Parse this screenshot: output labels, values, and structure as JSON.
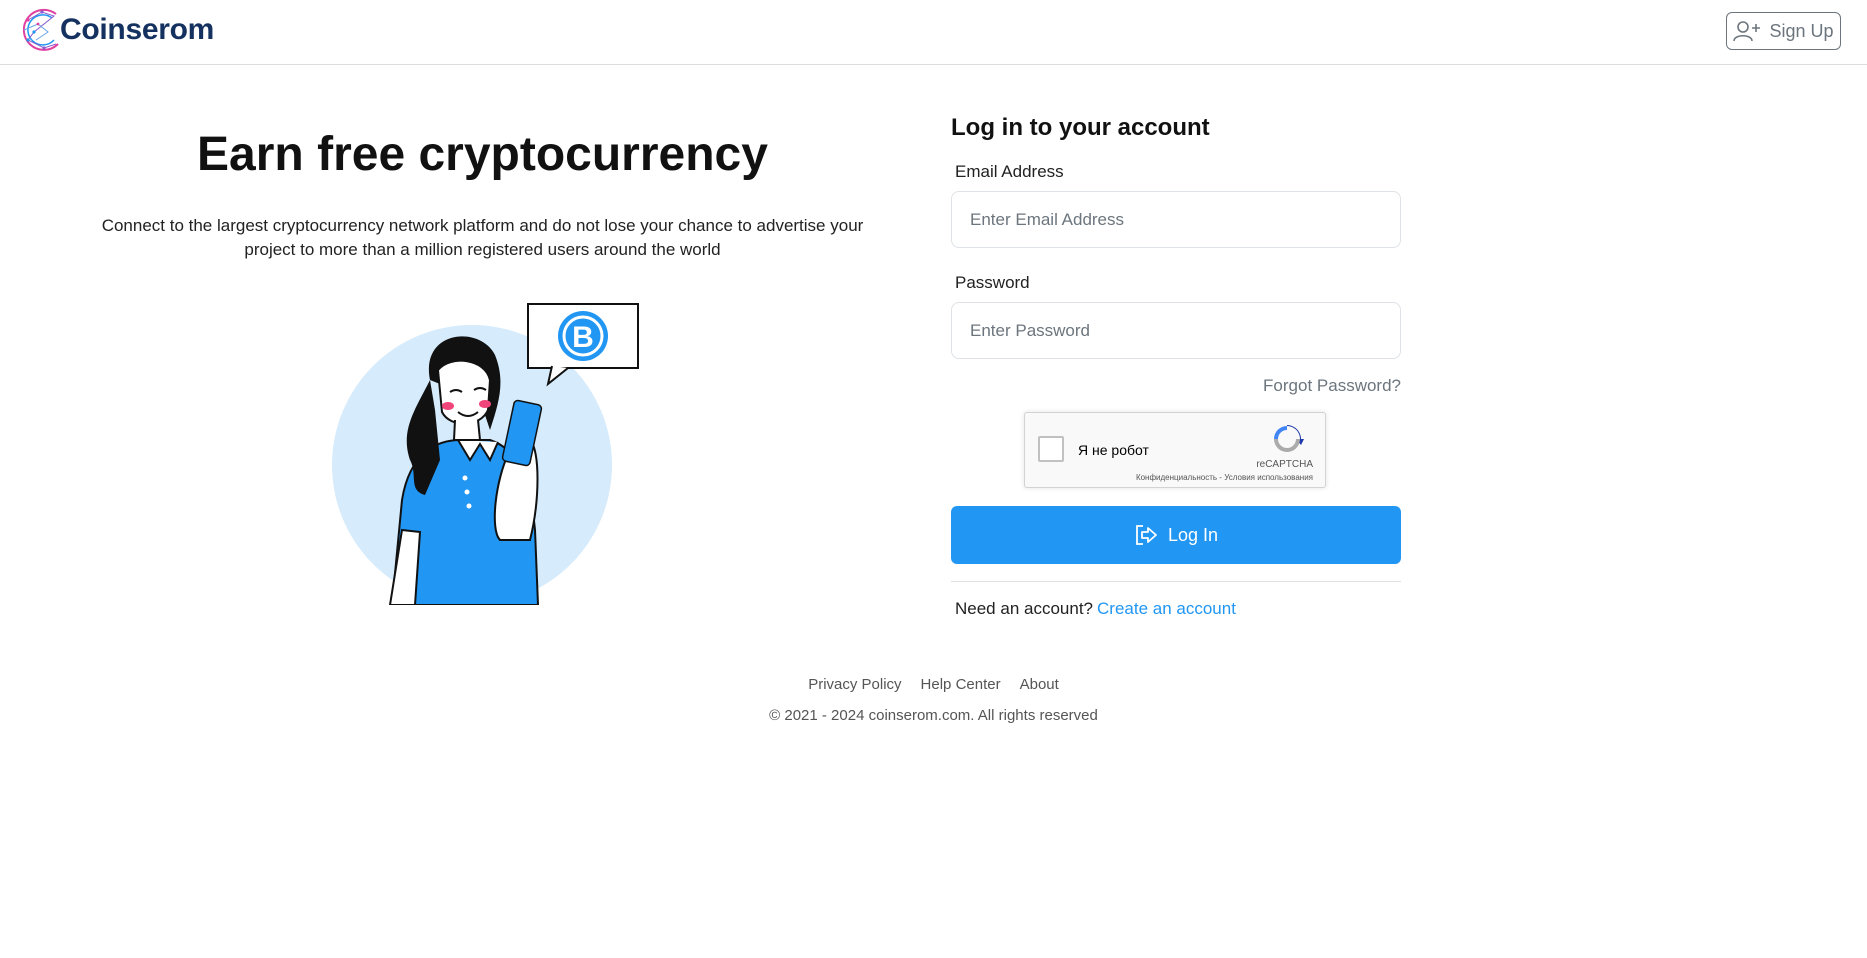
{
  "header": {
    "brand": "Coinserom",
    "signup_label": "Sign Up"
  },
  "hero": {
    "title": "Earn free cryptocurrency",
    "description": "Connect to the largest cryptocurrency network platform and do not lose your chance to advertise your project to more than a million registered users around the world"
  },
  "login": {
    "title": "Log in to your account",
    "email_label": "Email Address",
    "email_placeholder": "Enter Email Address",
    "email_value": "",
    "password_label": "Password",
    "password_placeholder": "Enter Password",
    "password_value": "",
    "forgot_label": "Forgot Password?",
    "captcha": {
      "label": "Я не робот",
      "brand": "reCAPTCHA",
      "links": "Конфиденциальность - Условия использования",
      "checked": false
    },
    "submit_label": "Log In",
    "need_account_text": "Need an account?",
    "create_account_label": "Create an account"
  },
  "footer": {
    "links": [
      "Privacy Policy",
      "Help Center",
      "About"
    ],
    "copyright": "© 2021 - 2024 coinserom.com. All rights reserved"
  },
  "colors": {
    "accent": "#2196f3",
    "brand_text": "#14315f",
    "illustration_bg": "#d6ebfb"
  },
  "icons": {
    "signup": "user-plus-icon",
    "login": "sign-in-icon",
    "bitcoin": "bitcoin-icon",
    "recaptcha": "recaptcha-logo-icon"
  }
}
